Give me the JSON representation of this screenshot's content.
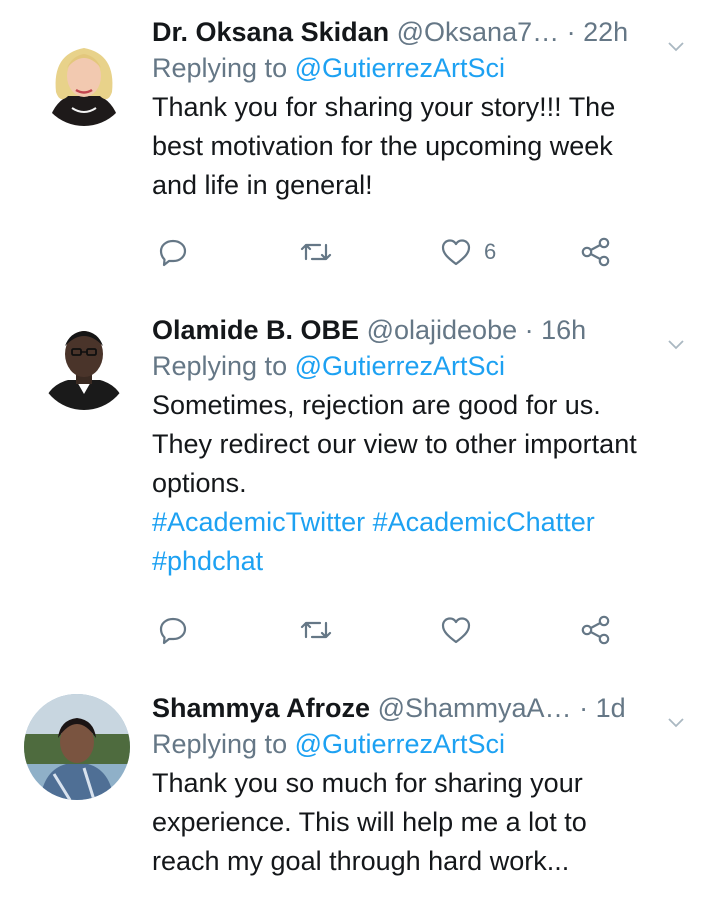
{
  "tweets": [
    {
      "name": "Dr. Oksana Skidan",
      "handle": "@Oksana7…",
      "dot": "·",
      "time": "22h",
      "replying_prefix": "Replying to",
      "replying_to": "@GutierrezArtSci",
      "text": "Thank you for sharing your story!!!  The\nbest motivation for the upcoming week\nand life in general!",
      "hashtags": [],
      "like_count": "6",
      "icons": {
        "reply": "reply-icon",
        "retweet": "retweet-icon",
        "like": "heart-icon",
        "share": "share-icon",
        "menu": "chevron-down-icon"
      }
    },
    {
      "name": "Olamide B. OBE",
      "handle": "@olajideobe",
      "dot": "·",
      "time": "16h",
      "replying_prefix": "Replying to",
      "replying_to": "@GutierrezArtSci",
      "text": "Sometimes, rejection are good for us.\nThey redirect our view to other important\noptions.",
      "hashtags": [
        "#AcademicTwitter",
        "#AcademicChatter",
        "#phdchat"
      ],
      "like_count": "",
      "icons": {
        "reply": "reply-icon",
        "retweet": "retweet-icon",
        "like": "heart-icon",
        "share": "share-icon",
        "menu": "chevron-down-icon"
      }
    },
    {
      "name": "Shammya Afroze",
      "handle": "@ShammyaA…",
      "dot": "·",
      "time": "1d",
      "replying_prefix": "Replying to",
      "replying_to": "@GutierrezArtSci",
      "text": "Thank you so much for sharing your\nexperience. This will help me a lot to\nreach my goal through hard work...",
      "hashtags": [],
      "like_count": "",
      "icons": {
        "reply": "reply-icon",
        "retweet": "retweet-icon",
        "like": "heart-icon",
        "share": "share-icon",
        "menu": "chevron-down-icon"
      }
    }
  ],
  "colors": {
    "text": "#14171a",
    "secondary": "#657786",
    "link": "#1da1f2",
    "icon": "#657786"
  }
}
